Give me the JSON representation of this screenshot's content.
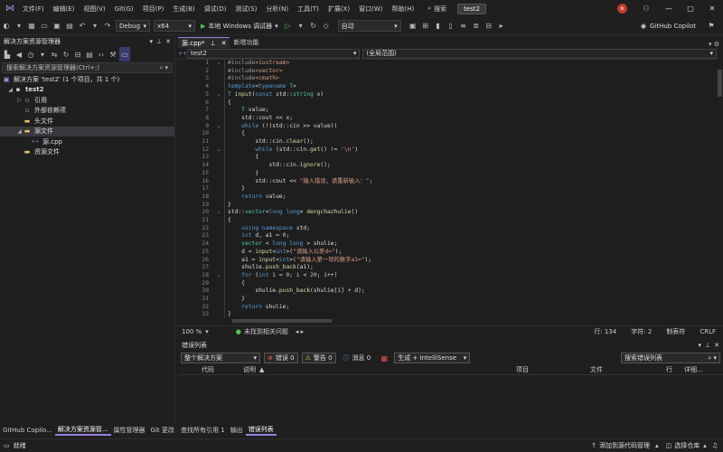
{
  "menubar": {
    "items": [
      "文件(F)",
      "编辑(E)",
      "视图(V)",
      "Git(G)",
      "项目(P)",
      "生成(B)",
      "调试(D)",
      "测试(S)",
      "分析(N)",
      "工具(T)",
      "扩展(X)",
      "窗口(W)",
      "帮助(H)"
    ],
    "search_label": "搜索",
    "solution_name": "test2",
    "avatar_text": "水",
    "minimize": "—",
    "maximize": "□",
    "close": "✕"
  },
  "toolbar": {
    "config": "Debug",
    "platform": "x64",
    "run_label": "本地 Windows 调试器",
    "auto_label": "自动",
    "copilot_label": "GitHub Copilot"
  },
  "solution_explorer": {
    "title": "解决方案资源管理器",
    "search_placeholder": "搜索解决方案资源管理器(Ctrl+;)",
    "items": [
      {
        "label": "解决方案 'test2' (1 个项目，共 1 个)"
      },
      {
        "label": "test2"
      },
      {
        "label": "引用"
      },
      {
        "label": "外部依赖项"
      },
      {
        "label": "头文件"
      },
      {
        "label": "源文件"
      },
      {
        "label": "源.cpp"
      },
      {
        "label": "资源文件"
      }
    ]
  },
  "editor": {
    "active_tab": "源.cpp*",
    "other_tab": "新增功能",
    "nav_left": "test2",
    "nav_right": "(全局范围)",
    "line_numbers": [
      "1",
      "2",
      "3",
      "4",
      "5",
      "6",
      "7",
      "8",
      "9",
      "10",
      "11",
      "12",
      "13",
      "14",
      "15",
      "16",
      "17",
      "18",
      "19",
      "20",
      "21",
      "22",
      "23",
      "24",
      "25",
      "26",
      "27",
      "28",
      "29",
      "30",
      "31",
      "32",
      "33"
    ],
    "zoom": "100 %",
    "issues": "未找到相关问题",
    "line_info": "行: 134",
    "char_info": "字符: 2",
    "tab_mode": "制表符",
    "eol": "CRLF"
  },
  "error_list": {
    "title": "错误列表",
    "scope": "整个解决方案",
    "errors": "错误 0",
    "warnings": "警告 0",
    "messages": "消息 0",
    "build_filter": "生成 + IntelliSense",
    "search_placeholder": "搜索错误列表",
    "columns": {
      "code": "代码",
      "desc": "说明",
      "project": "项目",
      "file": "文件",
      "line": "行",
      "detail": "详细..."
    }
  },
  "bottom_tabs_left": [
    "GitHub Copilo...",
    "解决方案资源管...",
    "属性管理器",
    "Git 更改"
  ],
  "bottom_tabs_right": [
    "查找所有引用 1",
    "输出",
    "错误列表"
  ],
  "statusbar": {
    "ready": "就绪",
    "add_source": "添加到源代码管理",
    "select_repo": "选择仓库"
  }
}
